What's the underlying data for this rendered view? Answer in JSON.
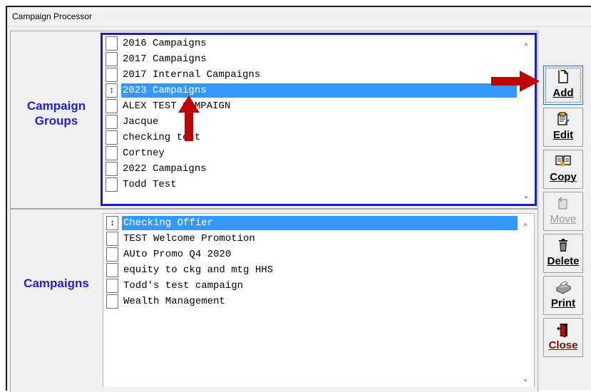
{
  "window": {
    "title": "Campaign Processor"
  },
  "groups": {
    "label": "Campaign Groups",
    "items": [
      {
        "mark": "",
        "label": "2016 Campaigns"
      },
      {
        "mark": "",
        "label": "2017 Campaigns"
      },
      {
        "mark": "",
        "label": "2017 Internal Campaigns"
      },
      {
        "mark": "↕",
        "label": "2023 Campaigns",
        "selected": true
      },
      {
        "mark": "",
        "label": "ALEX TEST CAMPAIGN"
      },
      {
        "mark": "",
        "label": "Jacque"
      },
      {
        "mark": "",
        "label": "checking test"
      },
      {
        "mark": "",
        "label": "Cortney"
      },
      {
        "mark": "",
        "label": "2022 Campaigns"
      },
      {
        "mark": "",
        "label": "Todd Test"
      }
    ]
  },
  "campaigns": {
    "label": "Campaigns",
    "items": [
      {
        "mark": "↕",
        "label": "Checking Offier",
        "selected": true
      },
      {
        "mark": "",
        "label": "TEST Welcome Promotion"
      },
      {
        "mark": "",
        "label": "AUto Promo Q4 2020"
      },
      {
        "mark": "",
        "label": "equity to ckg and mtg HHS"
      },
      {
        "mark": "",
        "label": "Todd's test campaign"
      },
      {
        "mark": "",
        "label": "Wealth Management"
      }
    ]
  },
  "toolbar": {
    "add": "Add",
    "edit": "Edit",
    "copy": "Copy",
    "move": "Move",
    "delete": "Delete",
    "print": "Print",
    "close": "Close"
  },
  "icons": {
    "add": "new-document-icon",
    "edit": "edit-document-icon",
    "copy": "copy-documents-icon",
    "move": "move-icon",
    "delete": "trash-icon",
    "print": "printer-icon",
    "close": "exit-door-icon",
    "annotation": "red-arrow"
  },
  "colors": {
    "label_blue": "#1e1ee0",
    "selection": "#3399ff",
    "focus_border": "#1b1bc8",
    "annotation_arrow": "#c00000",
    "close_label": "#8b0000"
  }
}
